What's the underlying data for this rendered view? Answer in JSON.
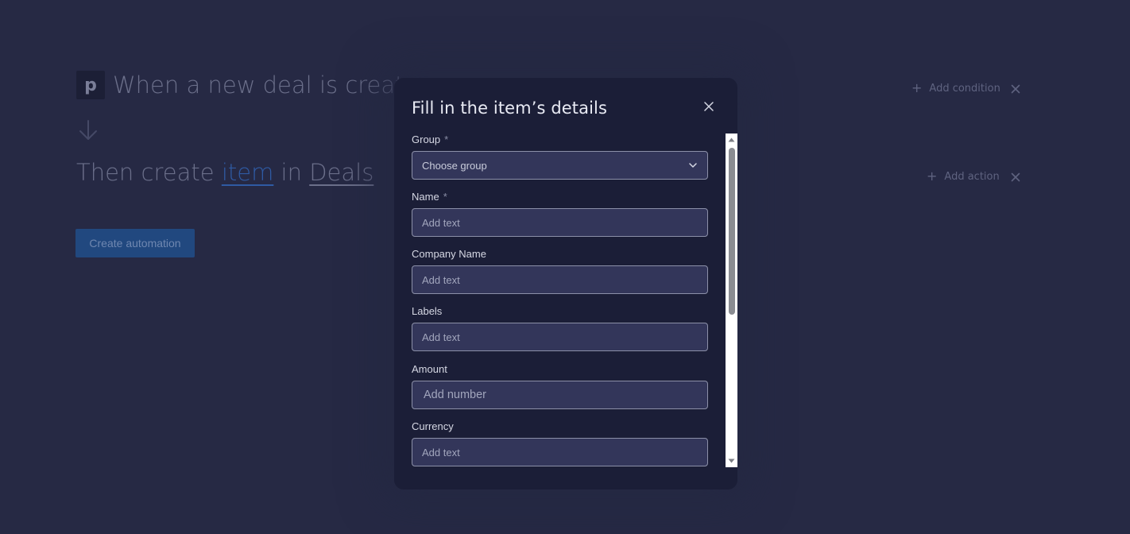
{
  "background": {
    "trigger": {
      "logo_glyph": "p",
      "sentence": "When a new deal is create"
    },
    "action": {
      "prefix": "Then create ",
      "item_link": "item",
      "middle": " in ",
      "board_link": "Deals"
    },
    "add_condition_label": "Add condition",
    "add_action_label": "Add action",
    "create_button_label": "Create automation"
  },
  "modal": {
    "title": "Fill in the item’s details",
    "required_mark": "*",
    "fields": [
      {
        "label": "Group",
        "required": true,
        "type": "select",
        "value": "Choose group"
      },
      {
        "label": "Name",
        "required": true,
        "type": "text",
        "placeholder": "Add text"
      },
      {
        "label": "Company Name",
        "required": false,
        "type": "text",
        "placeholder": "Add text"
      },
      {
        "label": "Labels",
        "required": false,
        "type": "text",
        "placeholder": "Add text"
      },
      {
        "label": "Amount",
        "required": false,
        "type": "number",
        "placeholder": "Add number"
      },
      {
        "label": "Currency",
        "required": false,
        "type": "text",
        "placeholder": "Add text"
      }
    ]
  },
  "icons": {
    "logo": "pipedrive-logo-icon",
    "arrow": "arrow-down-icon",
    "plus": "plus-icon",
    "close": "close-icon",
    "chevron": "chevron-down-icon",
    "scroll_up": "scroll-up-arrow-icon",
    "scroll_down": "scroll-down-arrow-icon"
  },
  "colors": {
    "page_bg": "#262944",
    "modal_bg": "#1b1e37",
    "input_bg": "#33365a",
    "link_blue": "#2f5aa3",
    "button_bg": "#21487f"
  }
}
